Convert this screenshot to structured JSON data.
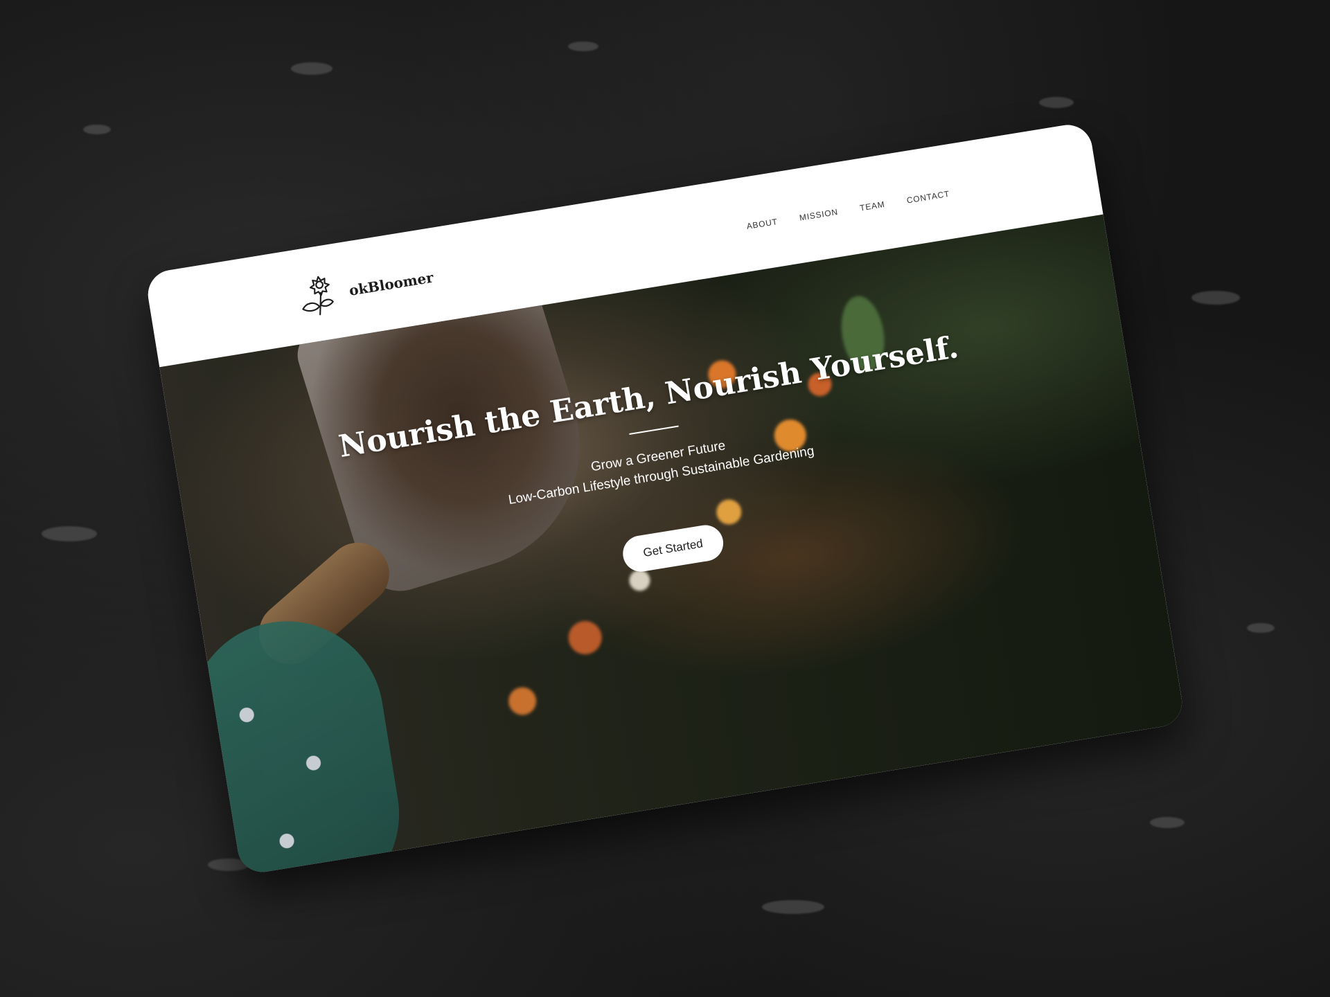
{
  "brand": {
    "name": "okBloomer",
    "logo_icon": "flower-icon"
  },
  "nav": {
    "items": [
      {
        "label": "ABOUT"
      },
      {
        "label": "MISSION"
      },
      {
        "label": "TEAM"
      },
      {
        "label": "CONTACT"
      }
    ]
  },
  "hero": {
    "title": "Nourish the Earth, Nourish Yourself.",
    "subtitle_line1": "Grow a Greener Future",
    "subtitle_line2": "Low-Carbon Lifestyle through Sustainable Gardening",
    "cta_label": "Get Started"
  },
  "colors": {
    "background": "#161616",
    "card": "#ffffff",
    "hero_dark": "#1e2217",
    "text_light": "#ffffff",
    "text_dark": "#1c1c1c"
  }
}
